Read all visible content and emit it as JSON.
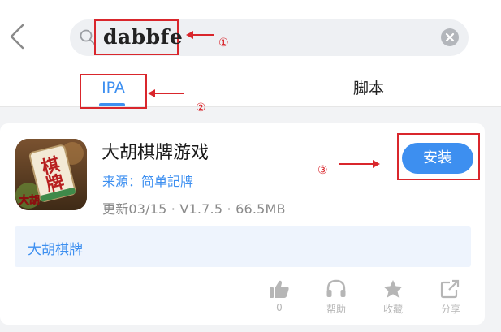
{
  "search": {
    "query": "dabbfe"
  },
  "tabs": [
    {
      "label": "IPA"
    },
    {
      "label": "脚本"
    }
  ],
  "app": {
    "name": "大胡棋牌游戏",
    "source": "来源：简单記牌",
    "meta": "更新03/15 · V1.7.5 · 66.5MB",
    "install_label": "安装",
    "tag": "大胡棋牌",
    "icon_text": {
      "top": "棋",
      "bottom": "牌",
      "corner": "大胡"
    }
  },
  "actions": [
    {
      "icon": "thumbs-up-icon",
      "label": "0"
    },
    {
      "icon": "headphones-icon",
      "label": "帮助"
    },
    {
      "icon": "star-icon",
      "label": "收藏"
    },
    {
      "icon": "share-icon",
      "label": "分享"
    }
  ],
  "annotations": [
    "①",
    "②",
    "③"
  ],
  "colors": {
    "accent": "#3d8ff0",
    "annotation": "#d9262c",
    "background": "#f2f3f5"
  }
}
